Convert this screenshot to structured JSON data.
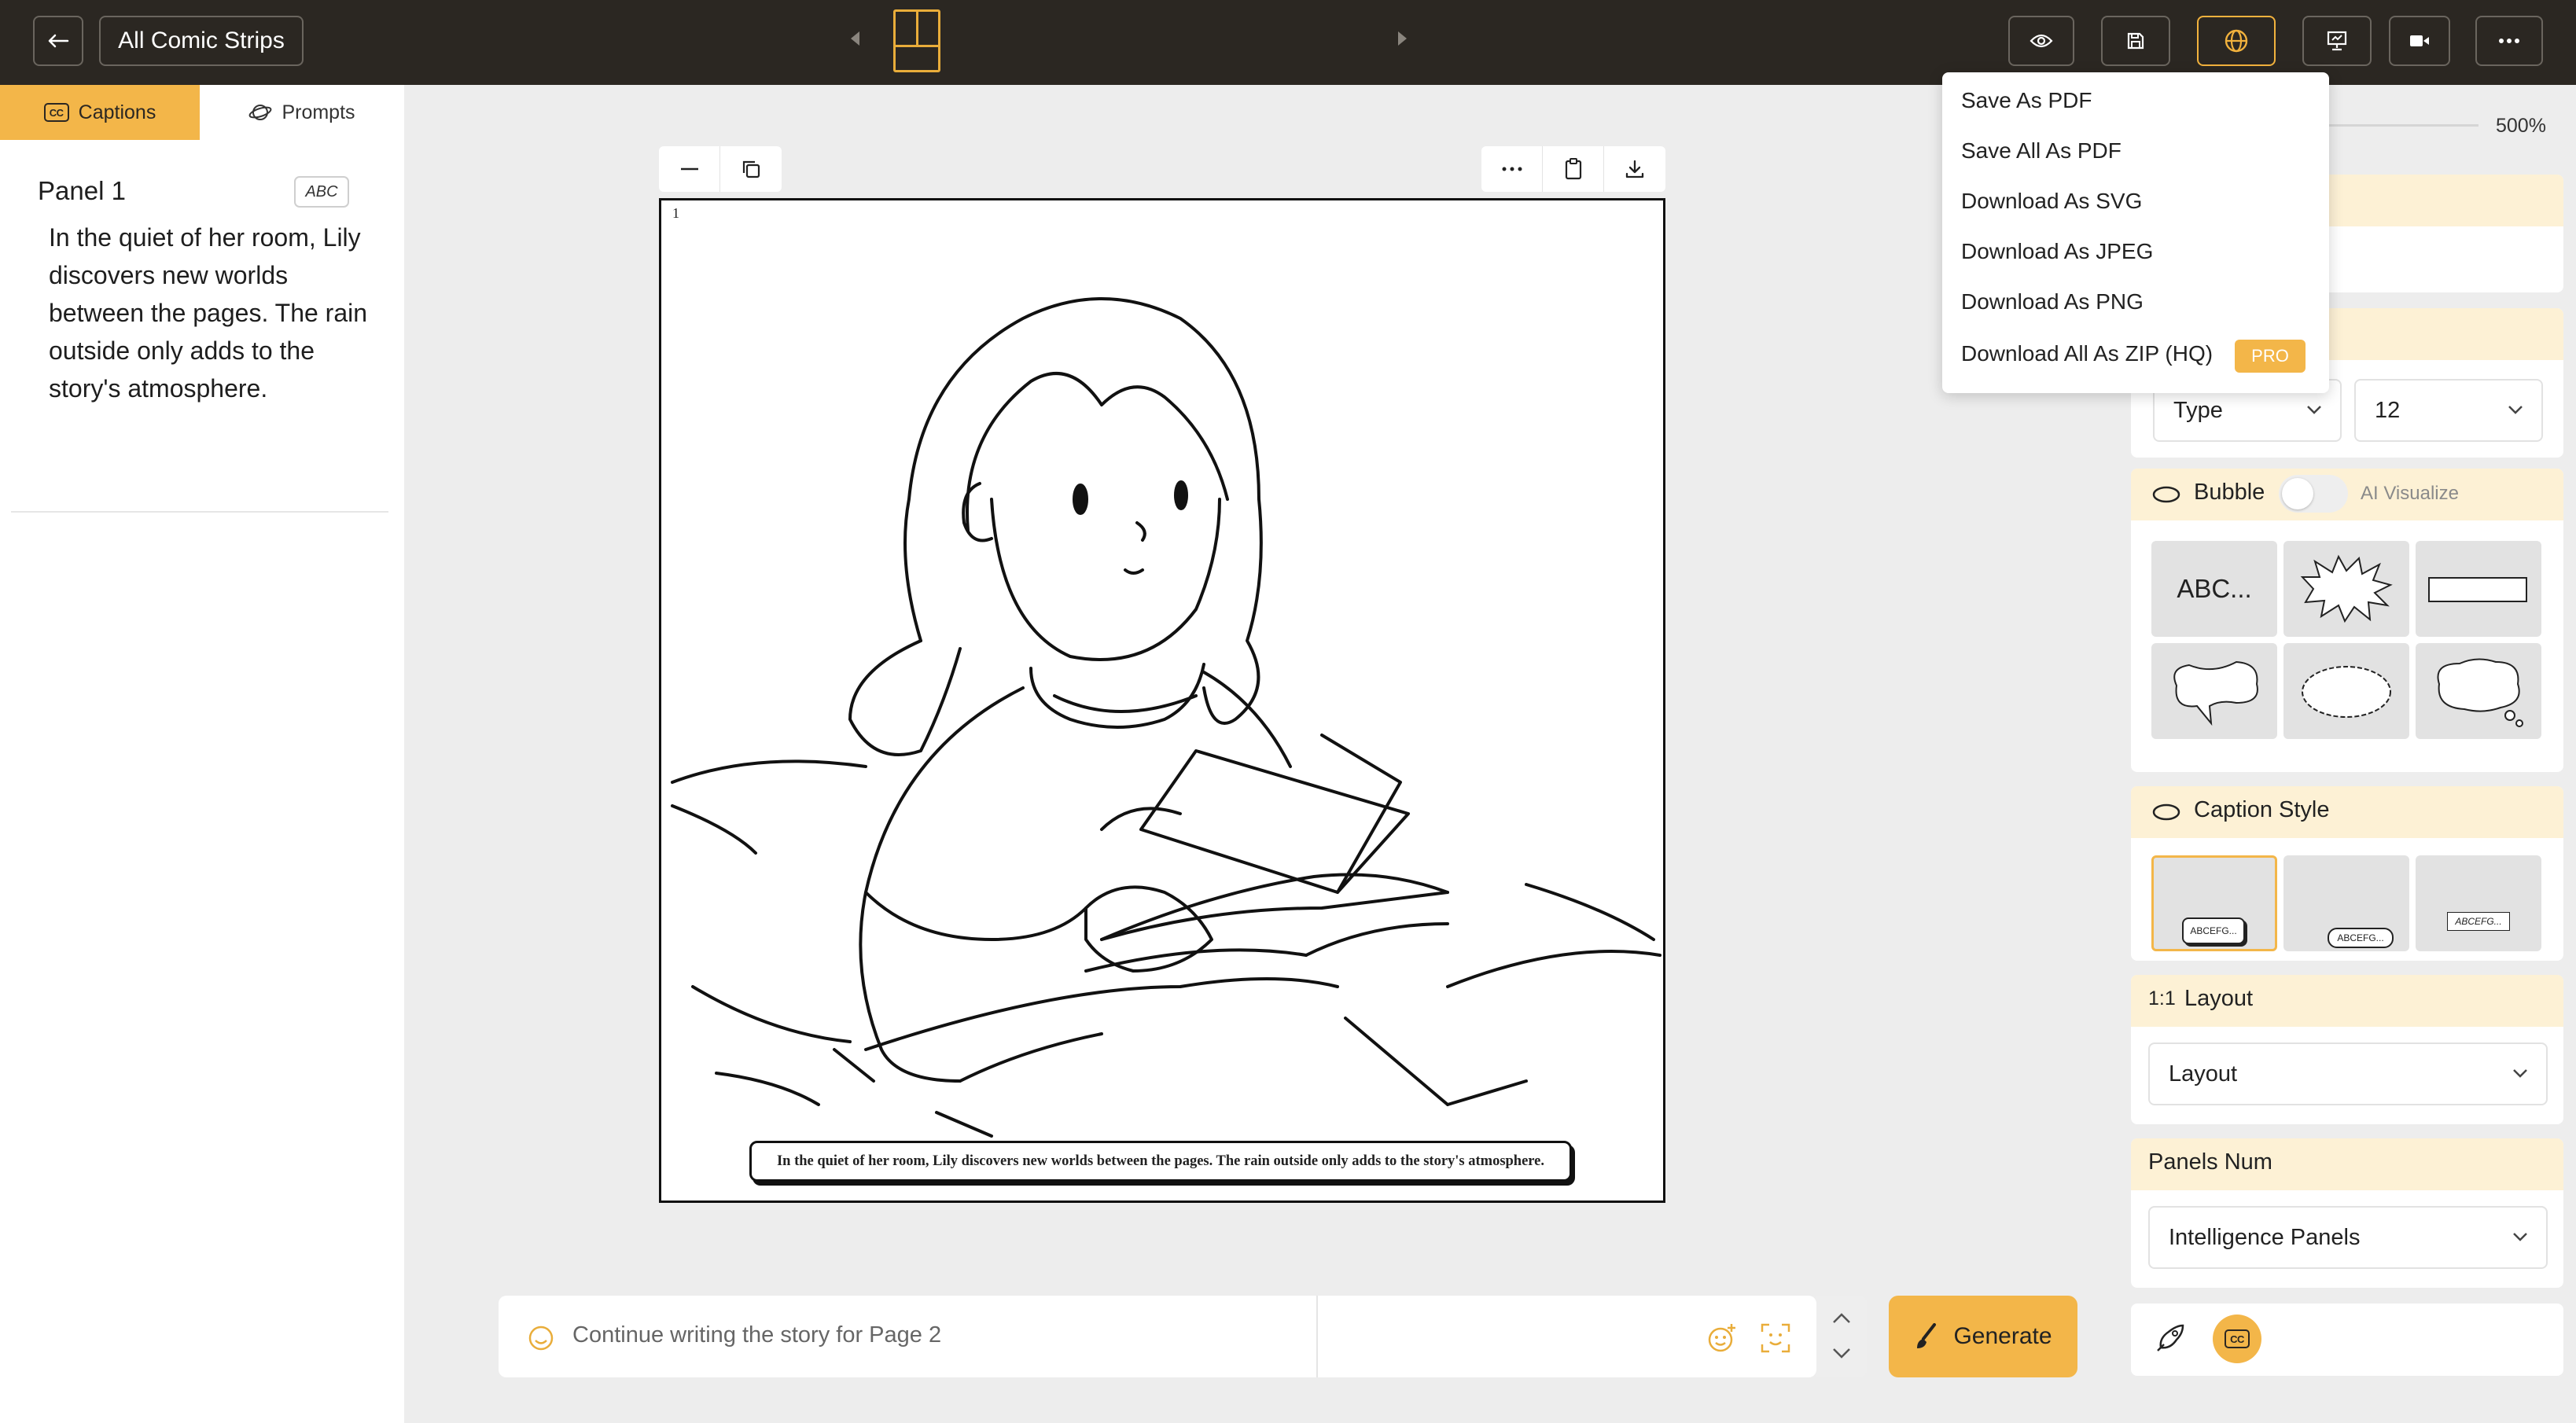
{
  "app": {
    "accent_color": "#f3b649",
    "topbar_color": "#2b2722"
  },
  "topbar": {
    "back_icon": "arrow-left-icon",
    "all_strips_label": "All Comic Strips",
    "tools": [
      "eye-icon",
      "save-icon",
      "globe-icon",
      "presentation-icon",
      "video-icon",
      "more-icon"
    ]
  },
  "sidebar": {
    "tabs": [
      {
        "label": "Captions",
        "icon": "cc-icon",
        "active": true
      },
      {
        "label": "Prompts",
        "icon": "planet-icon",
        "active": false
      }
    ],
    "cc_text": "CC",
    "panel": {
      "title": "Panel 1",
      "badge": "ABC",
      "text": "In the quiet of her room, Lily discovers new worlds between the pages. The rain outside only adds to the story's atmosphere."
    }
  },
  "canvas": {
    "panel_number": "1",
    "caption": "In the quiet of her room, Lily discovers new worlds between the pages. The rain outside only adds to the story's atmosphere."
  },
  "prompt": {
    "placeholder": "Continue writing the story for Page 2",
    "generate_label": "Generate"
  },
  "right_panel": {
    "zoom": "500%",
    "type_label": "Type",
    "font_size": "12",
    "bubble_title": "Bubble",
    "ai_visualize": "AI Visualize",
    "bubble_text_sample": "ABC...",
    "caption_style_title": "Caption Style",
    "caption_style_samples": [
      "ABCEFG...",
      "ABCEFG...",
      "ABCEFG..."
    ],
    "layout_prefix": "1:1",
    "layout_title": "Layout",
    "layout_value": "Layout",
    "panels_num_title": "Panels Num",
    "panels_num_value": "Intelligence Panels"
  },
  "menu": {
    "items": [
      "Save As PDF",
      "Save All As PDF",
      "Download As SVG",
      "Download As JPEG",
      "Download As PNG",
      "Download All As ZIP (HQ)"
    ],
    "pro_badge": "PRO"
  }
}
